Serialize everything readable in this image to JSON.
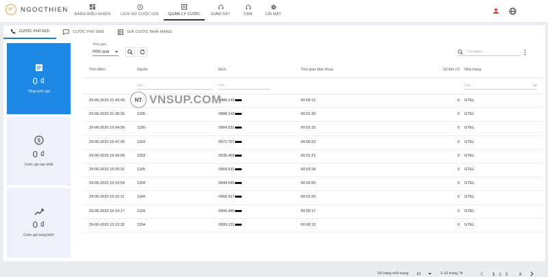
{
  "app": {
    "logo_initials": "NT",
    "logo_name": "NGOCTHIEN"
  },
  "nav": [
    {
      "label": "BẢNG ĐIỀU KHIỂN",
      "icon": "dashboard-icon"
    },
    {
      "label": "LỊCH SỬ CUỘC GỌI",
      "icon": "history-icon"
    },
    {
      "label": "QUẢN LÝ CƯỚC",
      "icon": "list-icon",
      "active": true
    },
    {
      "label": "GIÁM SÁT",
      "icon": "headset-icon"
    },
    {
      "label": "CRM",
      "icon": "headphones-icon"
    },
    {
      "label": "CÀI ĐẶT",
      "icon": "gear-icon"
    }
  ],
  "tabs": [
    {
      "label": "CƯỚC PHÍ GỌI",
      "icon": "phone-icon",
      "active": true
    },
    {
      "label": "CƯỚC PHÍ SMS",
      "icon": "sms-icon"
    },
    {
      "label": "GIÁ CƯỚC NHÀ MẠNG",
      "icon": "price-table-icon"
    }
  ],
  "summary": [
    {
      "value": "0 ₫",
      "caption": "Tổng cước gọi",
      "icon": "document-icon"
    },
    {
      "value": "0 ₫",
      "caption": "Cước gọi cao nhất",
      "icon": "dollar-icon"
    },
    {
      "value": "0 ₫",
      "caption": "Cước gọi trung bình",
      "icon": "trend-icon"
    }
  ],
  "filter": {
    "label": "Thời gian",
    "value": "Hôm qua"
  },
  "search": {
    "placeholder": "Tìm kiếm..."
  },
  "table": {
    "headers": [
      "Thời điểm",
      "Nguồn",
      "Đích",
      "Thời gian đàm thoại",
      "Số tiền (₫)",
      "Nhà mạng"
    ],
    "filter_placeholders": {
      "source": "Lọc...",
      "dest": "Lọc...",
      "network": "Lọc..."
    },
    "rows": [
      {
        "time": "29-06-2020 21:43:49",
        "source": "1103",
        "dest": "0888.142",
        "duration": "00:00:12",
        "amount": "0",
        "network": "GTEL"
      },
      {
        "time": "29-06-2020 21:39:35",
        "source": "1105",
        "dest": "0888.142",
        "duration": "00:01:30",
        "amount": "0",
        "network": "GTEL"
      },
      {
        "time": "29-06-2020 16:04:56",
        "source": "1105",
        "dest": "0964.531",
        "duration": "00:01:15",
        "amount": "0",
        "network": "GTEL"
      },
      {
        "time": "29-06-2020 15:47:05",
        "source": "1103",
        "dest": "0972.757",
        "duration": "00:00:23",
        "amount": "0",
        "network": "GTEL"
      },
      {
        "time": "29-06-2020 15:43:09",
        "source": "1103",
        "dest": "0935.455",
        "duration": "00:01:21",
        "amount": "0",
        "network": "GTEL"
      },
      {
        "time": "29-06-2020 15:20:31",
        "source": "1105",
        "dest": "0964.531",
        "duration": "00:03:18",
        "amount": "0",
        "network": "GTEL"
      },
      {
        "time": "29-06-2020 15:19:54",
        "source": "1104",
        "dest": "0944.545",
        "duration": "00:00:55",
        "amount": "0",
        "network": "GTEL"
      },
      {
        "time": "29-06-2020 15:15:11",
        "source": "1104",
        "dest": "0966.917",
        "duration": "00:02:29",
        "amount": "0",
        "network": "GTEL"
      },
      {
        "time": "29-06-2020 15:14:17",
        "source": "1104",
        "dest": "0906.445",
        "duration": "00:00:17",
        "amount": "0",
        "network": "GTEL"
      },
      {
        "time": "29-06-2020 15:13:32",
        "source": "1104",
        "dest": "0909.131",
        "duration": "00:00:13",
        "amount": "0",
        "network": "GTEL"
      }
    ]
  },
  "pagination": {
    "rows_per_page_label": "Số hàng mỗi trang",
    "rows_per_page": "10",
    "range": "1-10 trong 74",
    "pages": [
      "1",
      "2",
      "3",
      "...",
      "8"
    ]
  },
  "watermark": {
    "initials": "NT",
    "text": "VNSUP.COM"
  },
  "colors": {
    "accent": "#1e88e5",
    "logo": "#f2a33a",
    "user_icon": "#e53935"
  }
}
